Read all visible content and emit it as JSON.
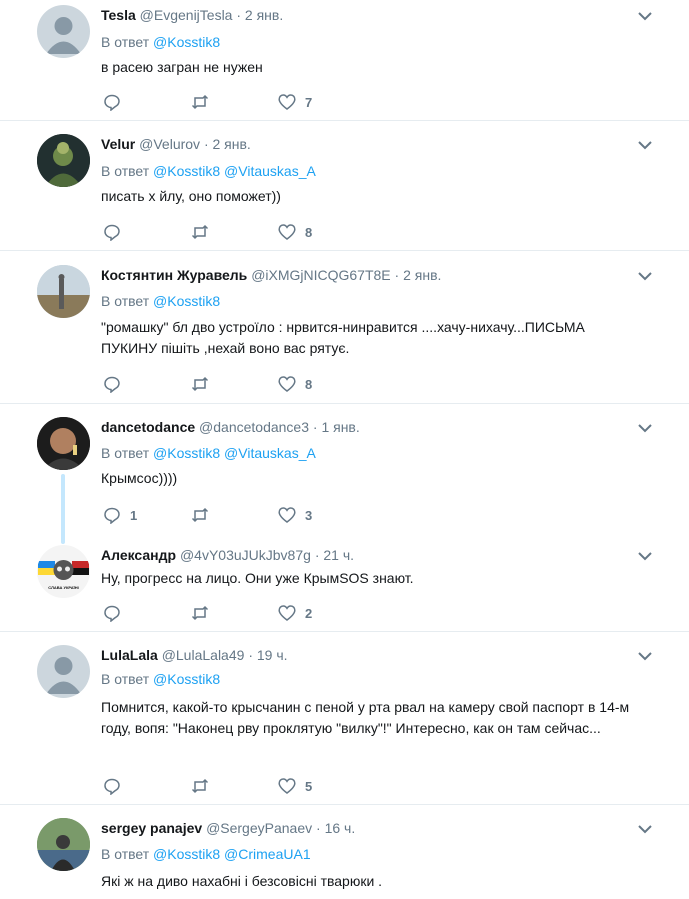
{
  "tweets": [
    {
      "name": "Tesla",
      "handle": "@EvgenijTesla",
      "time": "· 2 янв.",
      "reply_prefix": "В ответ",
      "reply_to": [
        "@Kosstik8"
      ],
      "text": "в расею загран не нужен",
      "replies": "",
      "likes": "7"
    },
    {
      "name": "Velur",
      "handle": "@Velurov",
      "time": "· 2 янв.",
      "reply_prefix": "В ответ",
      "reply_to": [
        "@Kosstik8",
        "@Vitauskas_A"
      ],
      "text": "писать х  йлу, оно поможет))",
      "replies": "",
      "likes": "8"
    },
    {
      "name": "Костянтин Журавель",
      "handle": "@iXMGjNICQG67T8E",
      "time": "· 2 янв.",
      "reply_prefix": "В ответ",
      "reply_to": [
        "@Kosstik8"
      ],
      "text": "\"ромашку\" бл  дво устроїло : нрвится-нинравится ....хачу-нихачу...ПИСЬМА ПУКИНУ пішіть ,нехай воно вас рятує.",
      "replies": "",
      "likes": "8"
    },
    {
      "name": "dancetodance",
      "handle": "@dancetodance3",
      "time": "· 1 янв.",
      "reply_prefix": "В ответ",
      "reply_to": [
        "@Kosstik8",
        "@Vitauskas_A"
      ],
      "text": "Крымсос))))",
      "replies": "1",
      "likes": "3"
    },
    {
      "name": "Александр",
      "handle": "@4vY03uJUkJbv87g",
      "time": "· 21 ч.",
      "reply_prefix": "",
      "reply_to": [],
      "text": "Ну, прогресс на лицо. Они уже КрымSOS знают.",
      "replies": "",
      "likes": "2"
    },
    {
      "name": "LulaLala",
      "handle": "@LulaLala49",
      "time": "· 19 ч.",
      "reply_prefix": "В ответ",
      "reply_to": [
        "@Kosstik8"
      ],
      "text": "Помнится, какой-то крысчанин с пеной у рта рвал на камеру свой паспорт в 14-м году, вопя: \"Наконец рву проклятую \"вилку\"!\" Интересно, как он там сейчас...",
      "replies": "",
      "likes": "5"
    },
    {
      "name": "sergey panajev",
      "handle": "@SergeyPanaev",
      "time": "· 16 ч.",
      "reply_prefix": "В ответ",
      "reply_to": [
        "@Kosstik8",
        "@CrimeaUA1"
      ],
      "text": "Які ж на диво нахабні і безсовісні тварюки .",
      "replies": "",
      "likes": ""
    }
  ],
  "avatars": {
    "avatar_text_5": "СЛАВА УКРАЇНІ"
  },
  "colors": {
    "link": "#1da1f2",
    "meta": "#657786",
    "divider": "#e6ecf0",
    "thread": "#c4e7fd"
  },
  "icons": {
    "reply": "reply-icon",
    "retweet": "retweet-icon",
    "like": "like-icon",
    "caret": "chevron-down-icon"
  }
}
